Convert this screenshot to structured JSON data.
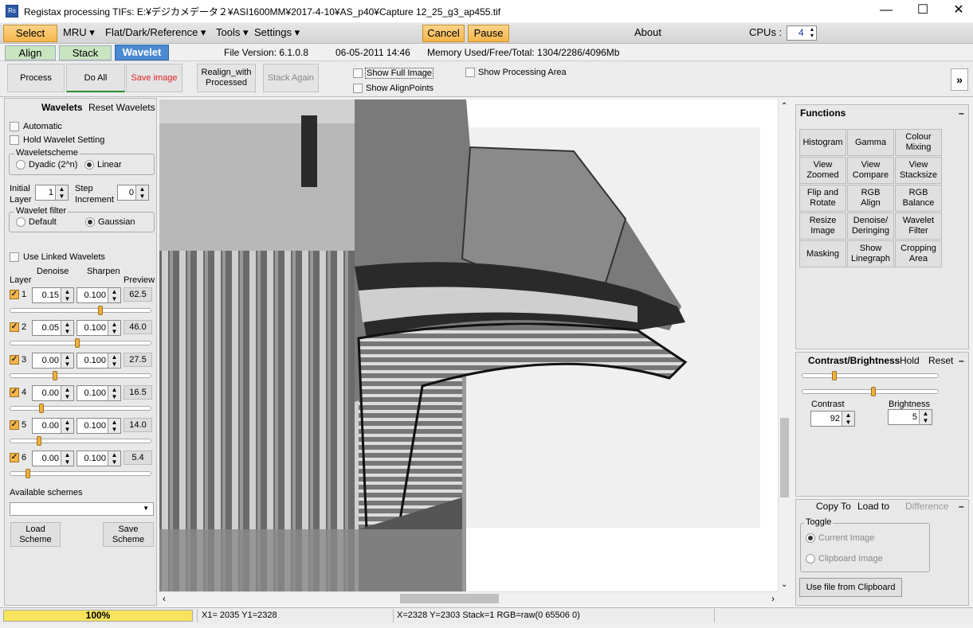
{
  "window": {
    "title": "Registax processing TIFs: E:¥デジカメデータ２¥ASI1600MM¥2017-4-10¥AS_p40¥Capture 12_25_g3_ap455.tif",
    "app_icon": "Rs",
    "minimize": "—",
    "maximize": "☐",
    "close": "✕"
  },
  "menu": {
    "select": "Select",
    "mru": "MRU ▾",
    "flat": "Flat/Dark/Reference ▾",
    "tools": "Tools ▾",
    "settings": "Settings ▾",
    "cancel": "Cancel",
    "pause": "Pause",
    "about": "About",
    "cpus_label": "CPUs :",
    "cpus_value": "4"
  },
  "tabs": [
    "Align",
    "Stack",
    "Wavelet"
  ],
  "info": {
    "file_version": "File Version: 6.1.0.8",
    "date": "06-05-2011 14:46",
    "memory": "Memory Used/Free/Total: 1304/2286/4096Mb"
  },
  "toolbar": {
    "process": "Process",
    "do_all": "Do All",
    "save_image": "Save image",
    "realign_line1": "Realign_with",
    "realign_line2": "Processed",
    "stack_again": "Stack Again",
    "show_full_image": "Show Full Image",
    "show_alignpoints": "Show AlignPoints",
    "show_processing_area": "Show Processing Area",
    "expand": "»"
  },
  "wavelets": {
    "title": "Wavelets",
    "reset": "Reset Wavelets",
    "automatic": "Automatic",
    "hold": "Hold Wavelet Setting",
    "scheme_title": "Waveletscheme",
    "dyadic": "Dyadic (2^n)",
    "linear": "Linear",
    "initial_layer_label1": "Initial",
    "initial_layer_label2": "Layer",
    "initial_layer_value": "1",
    "step_label1": "Step",
    "step_label2": "Increment",
    "step_value": "0",
    "filter_title": "Wavelet filter",
    "default": "Default",
    "gaussian": "Gaussian",
    "use_linked": "Use Linked Wavelets",
    "col_layer": "Layer",
    "col_denoise": "Denoise",
    "col_sharpen": "Sharpen",
    "col_preview": "Preview",
    "layers": [
      {
        "num": "1",
        "denoise": "0.15",
        "sharpen": "0.100",
        "preview": "62.5",
        "level": 0.64
      },
      {
        "num": "2",
        "denoise": "0.05",
        "sharpen": "0.100",
        "preview": "46.0",
        "level": 0.47
      },
      {
        "num": "3",
        "denoise": "0.00",
        "sharpen": "0.100",
        "preview": "27.5",
        "level": 0.31
      },
      {
        "num": "4",
        "denoise": "0.00",
        "sharpen": "0.100",
        "preview": "16.5",
        "level": 0.21
      },
      {
        "num": "5",
        "denoise": "0.00",
        "sharpen": "0.100",
        "preview": "14.0",
        "level": 0.19
      },
      {
        "num": "6",
        "denoise": "0.00",
        "sharpen": "0.100",
        "preview": "5.4",
        "level": 0.11
      }
    ],
    "available_schemes": "Available schemes",
    "load_line1": "Load",
    "load_line2": "Scheme",
    "save_line1": "Save",
    "save_line2": "Scheme"
  },
  "functions": {
    "title": "Functions",
    "collapse": "–",
    "buttons": [
      [
        "Histogram"
      ],
      [
        "Gamma"
      ],
      [
        "Colour",
        "Mixing"
      ],
      [
        "View",
        "Zoomed"
      ],
      [
        "View",
        "Compare"
      ],
      [
        "View",
        "Stacksize"
      ],
      [
        "Flip and",
        "Rotate"
      ],
      [
        "RGB",
        "Align"
      ],
      [
        "RGB",
        "Balance"
      ],
      [
        "Resize",
        "Image"
      ],
      [
        "Denoise/",
        "Deringing"
      ],
      [
        "Wavelet",
        "Filter"
      ],
      [
        "Masking"
      ],
      [
        "Show",
        "Linegraph"
      ],
      [
        "Cropping",
        "Area"
      ]
    ]
  },
  "contrast": {
    "title": "Contrast/Brightness",
    "hold": "Hold",
    "reset": "Reset",
    "collapse": "–",
    "contrast_label": "Contrast",
    "contrast_value": "92",
    "brightness_label": "Brightness",
    "brightness_value": "5"
  },
  "copy": {
    "copy_to": "Copy To",
    "load_to": "Load to",
    "difference": "Difference",
    "collapse": "–",
    "toggle": "Toggle",
    "current": "Current Image",
    "clipboard": "Clipboard Image",
    "use_file": "Use file from Clipboard"
  },
  "status": {
    "progress_label": "100%",
    "progress": 1.0,
    "xy1": "X1= 2035 Y1=2328",
    "xy2": "X=2328 Y=2303 Stack=1 RGB=raw(0 65506 0)"
  }
}
